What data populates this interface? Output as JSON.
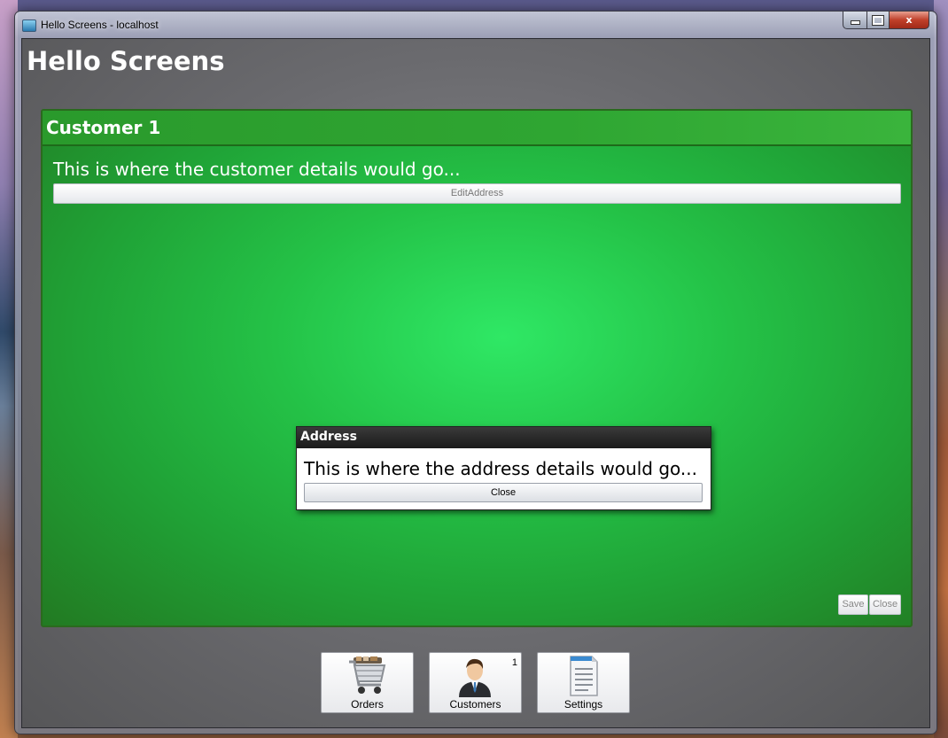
{
  "window": {
    "title": "Hello Screens - localhost",
    "caption": {
      "minimize": "",
      "maximize": "",
      "close": "x"
    }
  },
  "app": {
    "title": "Hello Screens"
  },
  "customer_screen": {
    "title": "Customer 1",
    "details_text": "This is where the customer details would go...",
    "edit_address_label": "EditAddress",
    "save_label": "Save",
    "close_label": "Close"
  },
  "address_dialog": {
    "title": "Address",
    "details_text": "This is where the address details would go...",
    "close_label": "Close"
  },
  "taskbar": {
    "items": [
      {
        "label": "Orders",
        "icon": "shopping-cart-icon",
        "badge": ""
      },
      {
        "label": "Customers",
        "icon": "customer-icon",
        "badge": "1"
      },
      {
        "label": "Settings",
        "icon": "settings-document-icon",
        "badge": ""
      }
    ]
  },
  "colors": {
    "panel_green": "#24c247",
    "header_green": "#2fa632",
    "dialog_header": "#1a1a1a"
  }
}
